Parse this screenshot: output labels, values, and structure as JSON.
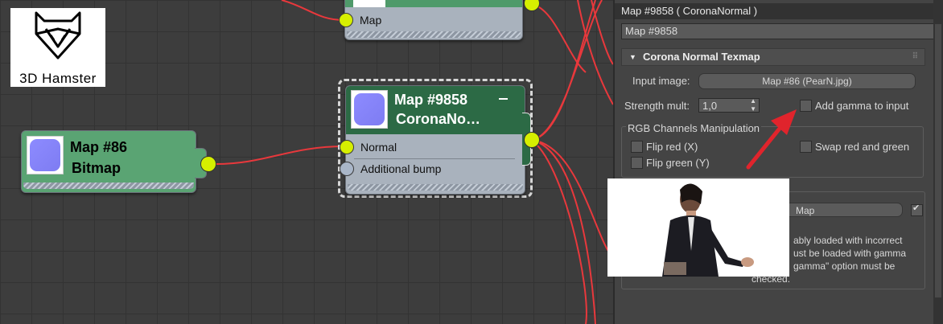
{
  "logo": {
    "text": "3D Hamster"
  },
  "nodes": {
    "top_partial": {
      "row_label": "Map"
    },
    "bitmap": {
      "title_line1": "Map #86",
      "title_line2": "Bitmap"
    },
    "corona": {
      "title_line1": "Map #9858",
      "title_line2": "CoronaNo…",
      "rows": [
        "Normal",
        "Additional bump"
      ]
    }
  },
  "panel": {
    "window_title": "Map #9858  ( CoronaNormal )",
    "name_field": "Map #9858",
    "rollout_title": "Corona Normal Texmap",
    "input_image_label": "Input image:",
    "input_image_value": "Map #86 (PearN.jpg)",
    "strength_label": "Strength mult:",
    "strength_value": "1,0",
    "add_gamma_label": "Add gamma to input",
    "rgb_group_title": "RGB Channels Manipulation",
    "flip_red": "Flip red (X)",
    "flip_green": "Flip green (Y)",
    "swap_rg": "Swap red and green",
    "lower_map_label": "Map",
    "note_lines": [
      "ably loaded with incorrect",
      "ust be loaded with gamma",
      "gamma\" option must be",
      "checked."
    ]
  },
  "colors": {
    "wire": "#e8383c",
    "socket_active": "#d6ef00",
    "node_header_bitmap": "#4f9a6a",
    "node_header_corona": "#2c6a45",
    "arrow": "#e0242c"
  }
}
